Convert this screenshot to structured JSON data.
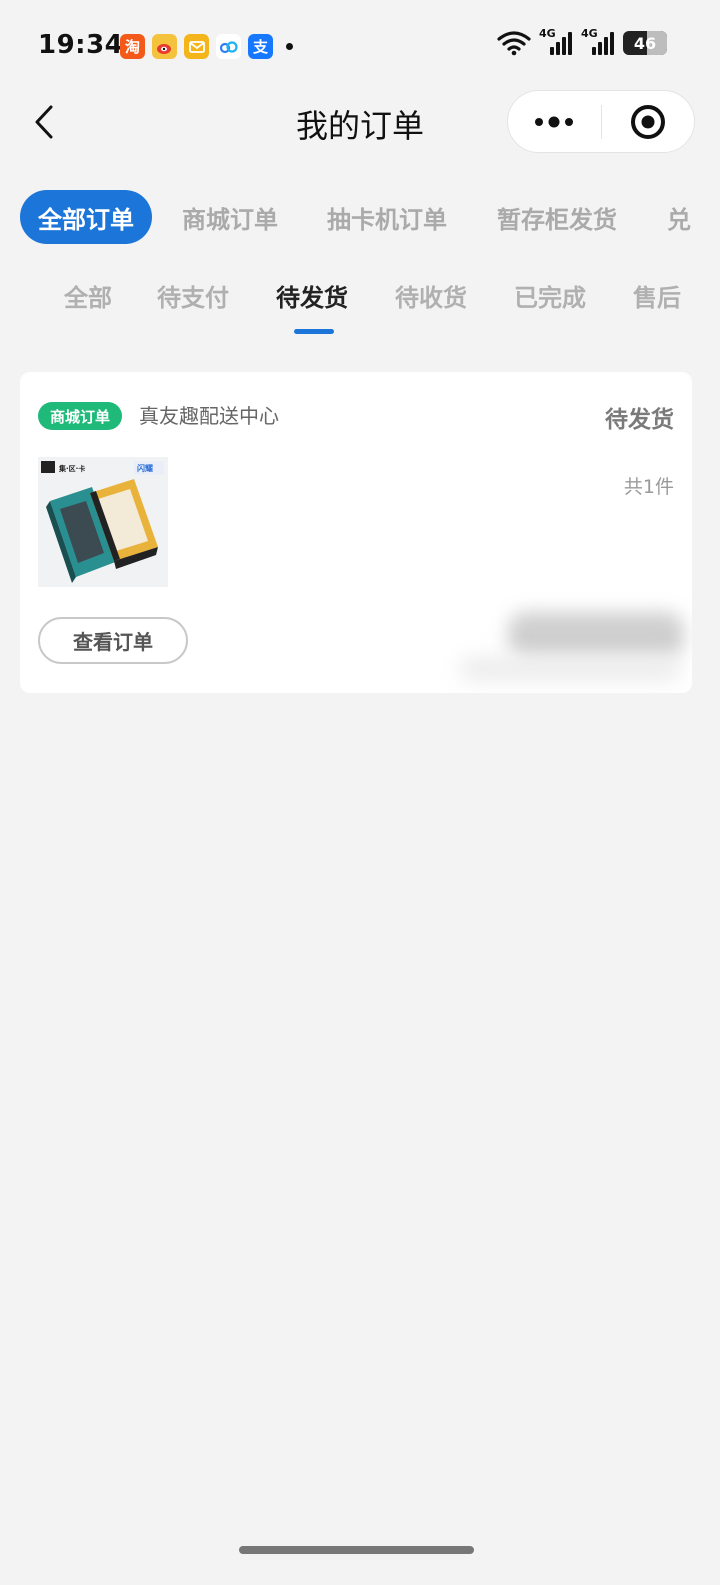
{
  "status_bar": {
    "time": "19:34",
    "app_icons": [
      {
        "name": "taobao-icon",
        "glyph": "淘",
        "color": "#f35a19"
      },
      {
        "name": "weibo-icon",
        "glyph": "",
        "color": "#f4c23d"
      },
      {
        "name": "mail-icon",
        "glyph": "",
        "color": "#f3b51a"
      },
      {
        "name": "cloud-icon",
        "glyph": "",
        "color": "#ffffff"
      },
      {
        "name": "alipay-icon",
        "glyph": "支",
        "color": "#1677ff"
      }
    ],
    "network_1": "4G",
    "network_2": "4G",
    "battery": "46"
  },
  "nav": {
    "title": "我的订单",
    "icons": {
      "back": "chevron-left-icon",
      "more": "more-dots-icon",
      "close": "target-close-icon"
    }
  },
  "primary_tabs": [
    {
      "label": "全部订单",
      "active": true
    },
    {
      "label": "商城订单",
      "active": false
    },
    {
      "label": "抽卡机订单",
      "active": false
    },
    {
      "label": "暂存柜发货",
      "active": false
    },
    {
      "label": "兑",
      "active": false
    }
  ],
  "secondary_tabs": [
    {
      "label": "全部",
      "active": false
    },
    {
      "label": "待支付",
      "active": false
    },
    {
      "label": "待发货",
      "active": true
    },
    {
      "label": "待收货",
      "active": false
    },
    {
      "label": "已完成",
      "active": false
    },
    {
      "label": "售后",
      "active": false
    }
  ],
  "order": {
    "badge": "商城订单",
    "shop": "真友趣配送中心",
    "status": "待发货",
    "count": "共1件",
    "view_button": "查看订单",
    "thumb_brand": "集·区·卡",
    "thumb_logo": "闪耀"
  },
  "colors": {
    "accent": "#1c75d8",
    "badge_green": "#1fba7a",
    "background": "#f3f3f3"
  }
}
